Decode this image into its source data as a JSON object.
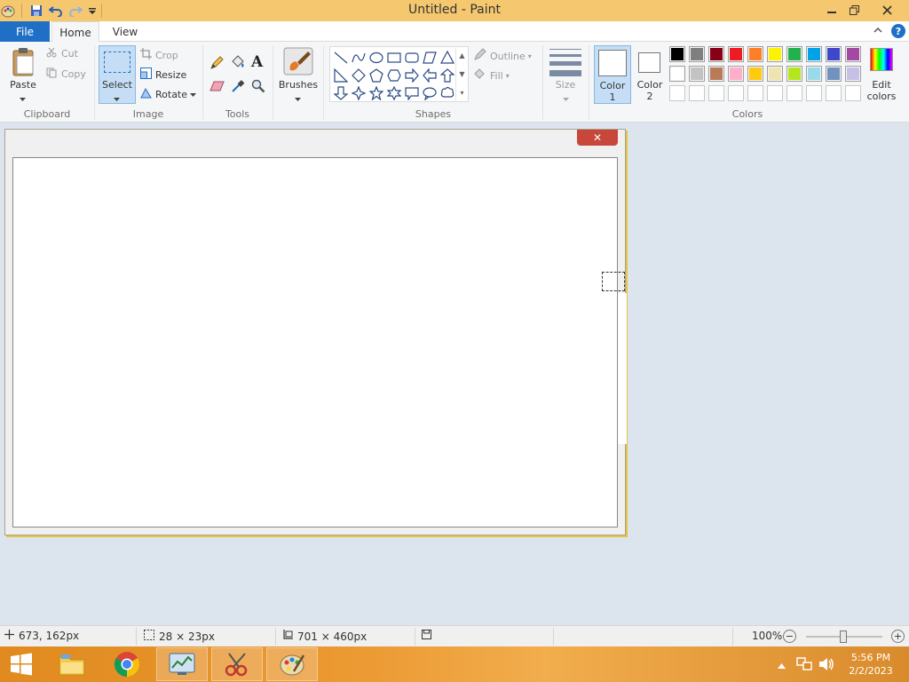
{
  "window": {
    "title": "Untitled - Paint"
  },
  "tabs": {
    "file": "File",
    "home": "Home",
    "view": "View"
  },
  "ribbon": {
    "clipboard": {
      "label": "Clipboard",
      "paste": "Paste",
      "cut": "Cut",
      "copy": "Copy"
    },
    "image": {
      "label": "Image",
      "select": "Select",
      "crop": "Crop",
      "resize": "Resize",
      "rotate": "Rotate"
    },
    "tools": {
      "label": "Tools"
    },
    "brushes": {
      "label": "Brushes"
    },
    "shapes": {
      "label": "Shapes",
      "outline": "Outline",
      "fill": "Fill"
    },
    "size": {
      "label": "Size"
    },
    "colors": {
      "label": "Colors",
      "color1_line1": "Color",
      "color1_line2": "1",
      "color2_line1": "Color",
      "color2_line2": "2",
      "edit_line1": "Edit",
      "edit_line2": "colors",
      "palette_row1": [
        "#000000",
        "#7f7f7f",
        "#880015",
        "#ed1c24",
        "#ff7f27",
        "#fff200",
        "#22b14c",
        "#00a2e8",
        "#3f48cc",
        "#a349a4"
      ],
      "palette_row2": [
        "#ffffff",
        "#c3c3c3",
        "#b97a57",
        "#ffaec9",
        "#ffc90e",
        "#efe4b0",
        "#b5e61d",
        "#99d9ea",
        "#7092be",
        "#c8bfe7"
      ]
    }
  },
  "status": {
    "cursor_pos": "673, 162px",
    "selection_size": "28 × 23px",
    "image_size": "701 × 460px",
    "zoom": "100%"
  },
  "taskbar": {
    "time": "5:56 PM",
    "date": "2/2/2023"
  }
}
